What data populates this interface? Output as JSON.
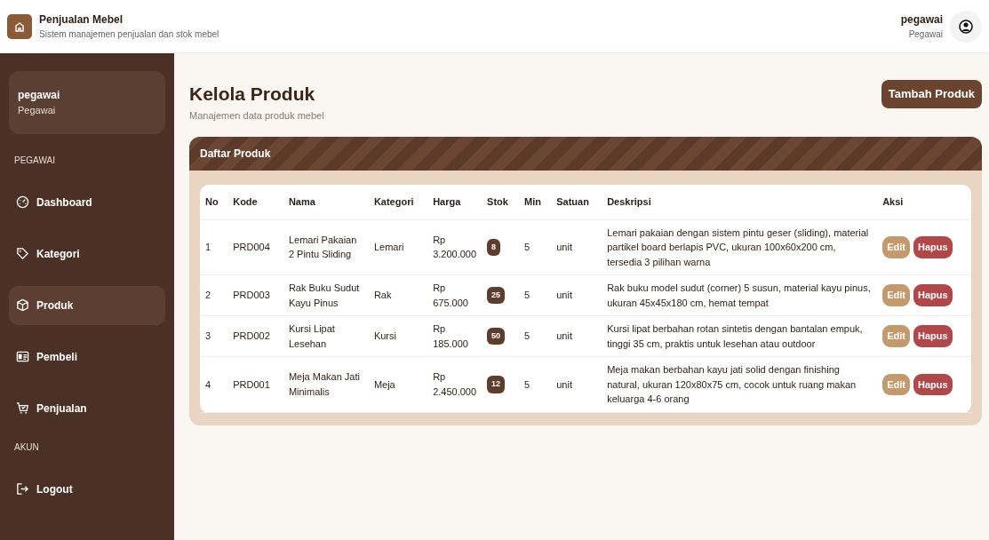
{
  "app": {
    "title": "Penjualan Mebel",
    "subtitle": "Sistem manajemen penjualan dan stok mebel"
  },
  "user": {
    "name": "pegawai",
    "role": "Pegawai"
  },
  "sidebar": {
    "user": {
      "name": "pegawai",
      "role": "Pegawai"
    },
    "sections": [
      {
        "label": "PEGAWAI",
        "items": [
          {
            "label": "Dashboard",
            "kind": "gauge",
            "selected": false
          },
          {
            "label": "Kategori",
            "kind": "tag",
            "selected": false
          },
          {
            "label": "Produk",
            "kind": "box",
            "selected": true
          },
          {
            "label": "Pembeli",
            "kind": "card",
            "selected": false
          },
          {
            "label": "Penjualan",
            "kind": "cart",
            "selected": false
          }
        ]
      },
      {
        "label": "AKUN",
        "items": [
          {
            "label": "Logout",
            "kind": "logout",
            "selected": false
          }
        ]
      }
    ]
  },
  "page": {
    "title": "Kelola Produk",
    "subtitle": "Manajemen data produk mebel",
    "add_button": "Tambah Produk"
  },
  "card": {
    "title": "Daftar Produk"
  },
  "table": {
    "columns": [
      "No",
      "Kode",
      "Nama",
      "Kategori",
      "Harga",
      "Stok",
      "Min",
      "Satuan",
      "Deskripsi",
      "Aksi"
    ],
    "rows": [
      {
        "no": "1",
        "code": "PRD004",
        "name": "Lemari Pakaian 2 Pintu Sliding",
        "category": "Lemari",
        "price": "Rp 3.200.000",
        "stock": "8",
        "min": "5",
        "unit": "unit",
        "description": "Lemari pakaian dengan sistem pintu geser (sliding), material partikel board berlapis PVC, ukuran 100x60x200 cm, tersedia 3 pilihan warna",
        "actions": [
          "Edit",
          "Hapus"
        ]
      },
      {
        "no": "2",
        "code": "PRD003",
        "name": "Rak Buku Sudut Kayu Pinus",
        "category": "Rak",
        "price": "Rp 675.000",
        "stock": "25",
        "min": "5",
        "unit": "unit",
        "description": "Rak buku model sudut (corner) 5 susun, material kayu pinus, ukuran 45x45x180 cm, hemat tempat",
        "actions": [
          "Edit",
          "Hapus"
        ]
      },
      {
        "no": "3",
        "code": "PRD002",
        "name": "Kursi Lipat Lesehan",
        "category": "Kursi",
        "price": "Rp 185.000",
        "stock": "50",
        "min": "5",
        "unit": "unit",
        "description": "Kursi lipat berbahan rotan sintetis dengan bantalan empuk, tinggi 35 cm, praktis untuk lesehan atau outdoor",
        "actions": [
          "Edit",
          "Hapus"
        ]
      },
      {
        "no": "4",
        "code": "PRD001",
        "name": "Meja Makan Jati Minimalis",
        "category": "Meja",
        "price": "Rp 2.450.000",
        "stock": "12",
        "min": "5",
        "unit": "unit",
        "description": "Meja makan berbahan kayu jati solid dengan finishing natural, ukuran 120x80x75 cm, cocok untuk ruang makan keluarga 4-6 orang",
        "actions": [
          "Edit",
          "Hapus"
        ]
      }
    ]
  }
}
